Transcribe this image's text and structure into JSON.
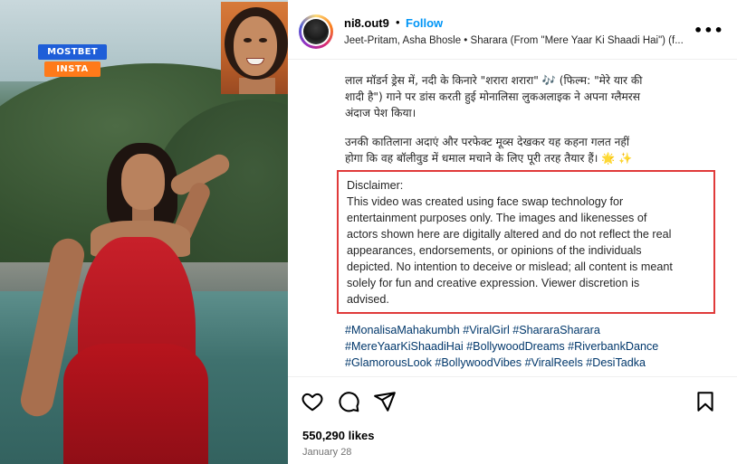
{
  "brand": {
    "line1": "MOSTBET",
    "line2": "INSTA"
  },
  "post": {
    "username": "ni8.out9",
    "separator": "•",
    "follow_label": "Follow",
    "audio": "Jeet-Pritam, Asha Bhosle • Sharara (From \"Mere Yaar Ki Shaadi Hai\") (f...",
    "more_icon": "more-horizontal-icon",
    "more_label": "•••"
  },
  "caption": {
    "hindi_lines": [
      "लाल मॉडर्न ड्रेस में, नदी के किनारे \"शरारा शरारा\" 🎶 (फिल्म: \"मेरे यार की",
      "शादी है\") गाने पर डांस करती हुई मोनालिसा लुकअलाइक ने अपना ग्लैमरस",
      "अंदाज पेश किया।",
      "उनकी कातिलाना अदाएं और परफेक्ट मूव्स देखकर यह कहना गलत नहीं",
      "होगा कि वह बॉलीवुड में धमाल मचाने के लिए पूरी तरह तैयार हैं। 🌟 ✨"
    ],
    "disclaimer_lines": [
      "Disclaimer:",
      "This video was created using face swap technology for",
      "entertainment purposes only. The images and likenesses of",
      "actors shown here are digitally altered and do not reflect the real",
      "appearances, endorsements, or opinions of the individuals",
      "depicted. No intention to deceive or mislead; all content is meant",
      "solely for fun and creative expression. Viewer discretion is",
      "advised."
    ],
    "hashtag_lines": [
      "#MonalisaMahakumbh #ViralGirl #ShararaSharara",
      "#MereYaarKiShaadiHai #BollywoodDreams #RiverbankDance",
      "#GlamorousLook #BollywoodVibes #ViralReels #DesiTadka"
    ]
  },
  "actions": {
    "icons": [
      "heart-icon",
      "comment-icon",
      "share-icon",
      "bookmark-icon"
    ]
  },
  "likes": "550,290 likes",
  "date": "January 28",
  "colors": {
    "follow": "#0095f6",
    "hashtag": "#00376b",
    "highlight_border": "#e03a3a"
  }
}
